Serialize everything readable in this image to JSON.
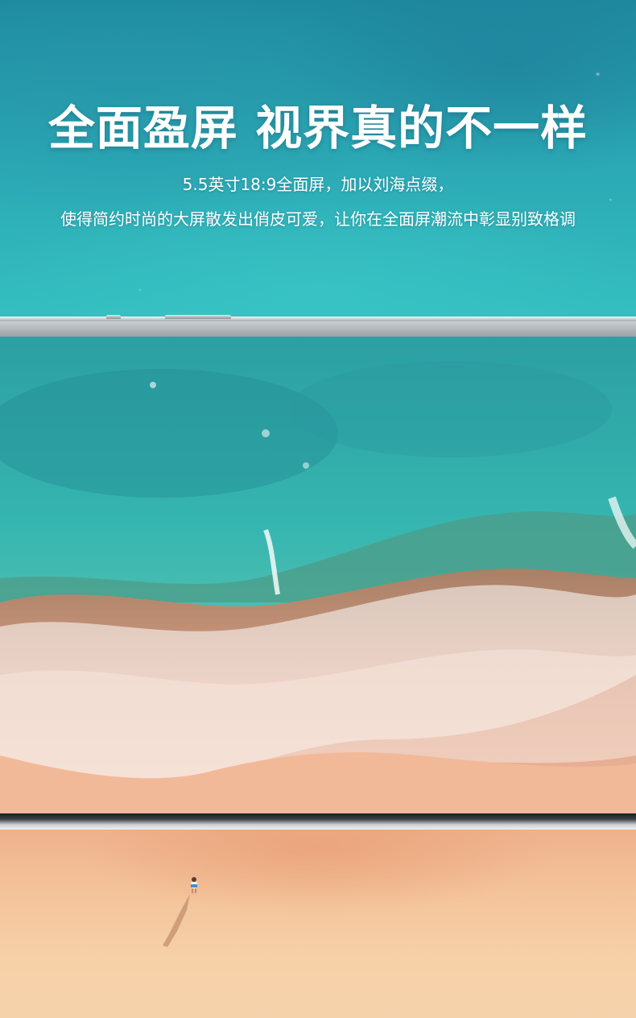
{
  "hero": {
    "headline": "全面盈屏 视界真的不一样",
    "subline_1": "5.5英寸18:9全面屏，加以刘海点缀，",
    "subline_2": "使得简约时尚的大屏散发出俏皮可爱，让你在全面屏潮流中彰显别致格调"
  },
  "colors": {
    "ocean": "#2aa6b3",
    "foam": "#ffffff",
    "sand": "#f4c49b",
    "frame": "#1a1c1e"
  },
  "icons": {
    "phone": "phone-frame",
    "person": "beach-person-icon"
  }
}
